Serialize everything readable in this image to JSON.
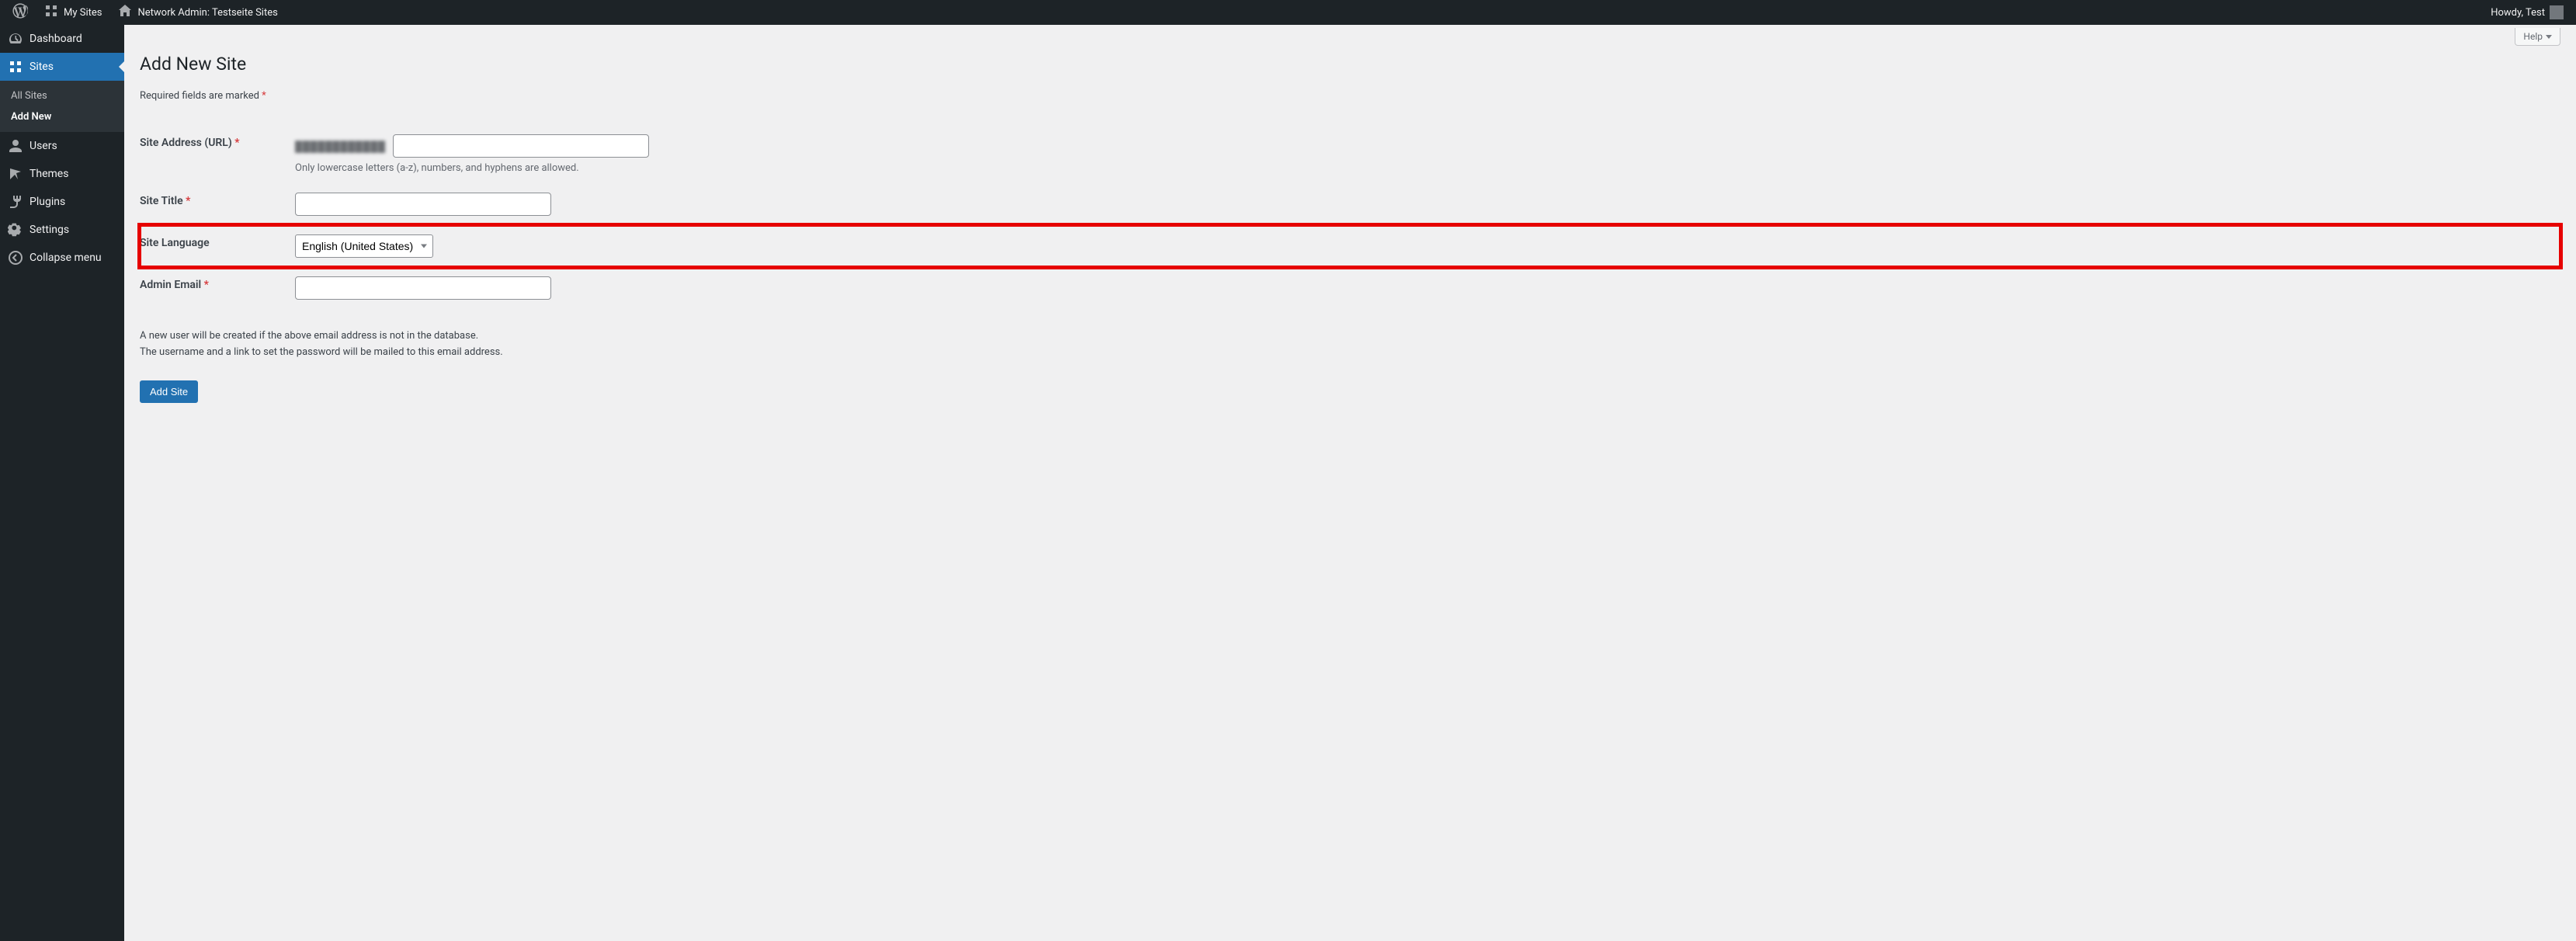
{
  "adminbar": {
    "my_sites": "My Sites",
    "network_admin": "Network Admin: Testseite Sites",
    "howdy": "Howdy, Test"
  },
  "sidebar": {
    "dashboard": "Dashboard",
    "sites": "Sites",
    "all_sites": "All Sites",
    "add_new": "Add New",
    "users": "Users",
    "themes": "Themes",
    "plugins": "Plugins",
    "settings": "Settings",
    "collapse": "Collapse menu"
  },
  "help_label": "Help",
  "page": {
    "title": "Add New Site",
    "required_note": "Required fields are marked ",
    "asterisk": "*"
  },
  "fields": {
    "site_address_label": "Site Address (URL) ",
    "site_address_prefix": "████████████",
    "site_address_value": "",
    "site_address_desc": "Only lowercase letters (a-z), numbers, and hyphens are allowed.",
    "site_title_label": "Site Title ",
    "site_title_value": "",
    "site_language_label": "Site Language",
    "site_language_value": "English (United States)",
    "admin_email_label": "Admin Email ",
    "admin_email_value": "",
    "note_line1": "A new user will be created if the above email address is not in the database.",
    "note_line2": "The username and a link to set the password will be mailed to this email address.",
    "submit_label": "Add Site"
  }
}
